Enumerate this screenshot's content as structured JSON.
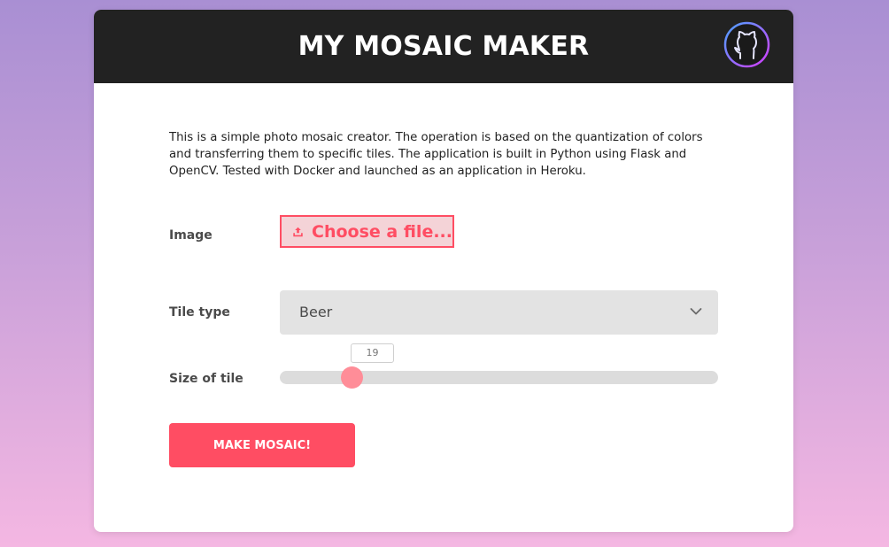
{
  "header": {
    "title": "MY MOSAIC MAKER",
    "github_icon": "github-octocat-icon"
  },
  "description": "This is a simple photo mosaic creator. The operation is based on the quantization of colors and transferring them to specific tiles. The application is built in Python using Flask and OpenCV. Tested with Docker and launched as an application in Heroku.",
  "form": {
    "image": {
      "label": "Image",
      "button_label": "Choose a file...",
      "icon": "upload-icon"
    },
    "tile_type": {
      "label": "Tile type",
      "selected": "Beer",
      "icon": "chevron-down-icon"
    },
    "tile_size": {
      "label": "Size of tile",
      "value": "19"
    },
    "submit_label": "MAKE MOSAIC!"
  },
  "colors": {
    "accent": "#ff4d63",
    "header_bg": "#222222",
    "slider_thumb": "#ff8d98"
  }
}
